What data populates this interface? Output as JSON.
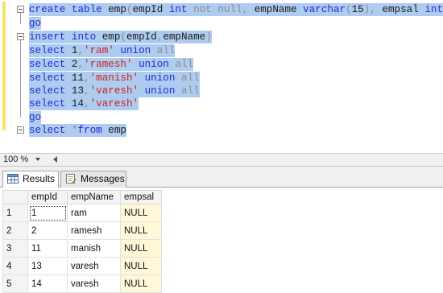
{
  "editor": {
    "lines": [
      {
        "parts": [
          [
            "kw",
            "create table "
          ],
          [
            "plain",
            "emp"
          ],
          [
            "gray",
            "("
          ],
          [
            "plain",
            "empId "
          ],
          [
            "kw",
            "int "
          ],
          [
            "gray",
            "not null"
          ],
          [
            "gray",
            ", "
          ],
          [
            "plain",
            "empName "
          ],
          [
            "kw",
            "varchar"
          ],
          [
            "gray",
            "("
          ],
          [
            "plain",
            "15"
          ],
          [
            "gray",
            "), "
          ],
          [
            "plain",
            "empsal "
          ],
          [
            "kw",
            "int"
          ],
          [
            "gray",
            ")"
          ]
        ]
      },
      {
        "parts": [
          [
            "kw",
            "go"
          ]
        ]
      },
      {
        "parts": [
          [
            "kw",
            "insert into "
          ],
          [
            "plain",
            "emp"
          ],
          [
            "gray",
            "("
          ],
          [
            "plain",
            "empId"
          ],
          [
            "gray",
            ","
          ],
          [
            "plain",
            "empName"
          ],
          [
            "gray",
            ")"
          ]
        ]
      },
      {
        "parts": [
          [
            "kw",
            "select "
          ],
          [
            "plain",
            "1"
          ],
          [
            "gray",
            ","
          ],
          [
            "str",
            "'ram' "
          ],
          [
            "kw",
            "union "
          ],
          [
            "gray",
            "all"
          ]
        ]
      },
      {
        "parts": [
          [
            "kw",
            "select "
          ],
          [
            "plain",
            "2"
          ],
          [
            "gray",
            ","
          ],
          [
            "str",
            "'ramesh' "
          ],
          [
            "kw",
            "union "
          ],
          [
            "gray",
            "all"
          ]
        ]
      },
      {
        "parts": [
          [
            "kw",
            "select "
          ],
          [
            "plain",
            "11"
          ],
          [
            "gray",
            ","
          ],
          [
            "str",
            "'manish' "
          ],
          [
            "kw",
            "union "
          ],
          [
            "gray",
            "all"
          ]
        ]
      },
      {
        "parts": [
          [
            "kw",
            "select "
          ],
          [
            "plain",
            "13"
          ],
          [
            "gray",
            ","
          ],
          [
            "str",
            "'varesh' "
          ],
          [
            "kw",
            "union "
          ],
          [
            "gray",
            "all"
          ]
        ]
      },
      {
        "parts": [
          [
            "kw",
            "select "
          ],
          [
            "plain",
            "14"
          ],
          [
            "gray",
            ","
          ],
          [
            "str",
            "'varesh'"
          ]
        ]
      },
      {
        "parts": [
          [
            "kw",
            "go"
          ]
        ]
      },
      {
        "parts": [
          [
            "kw",
            "select "
          ],
          [
            "gray",
            "*"
          ],
          [
            "kw",
            "from "
          ],
          [
            "plain",
            "emp"
          ]
        ]
      }
    ]
  },
  "status": {
    "zoom": "100 %"
  },
  "tabs": {
    "results": "Results",
    "messages": "Messages"
  },
  "grid": {
    "columns": [
      "empId",
      "empName",
      "empsal"
    ],
    "rows": [
      {
        "num": "1",
        "empId": "1",
        "empName": "ram",
        "empsal": "NULL"
      },
      {
        "num": "2",
        "empId": "2",
        "empName": "ramesh",
        "empsal": "NULL"
      },
      {
        "num": "3",
        "empId": "11",
        "empName": "manish",
        "empsal": "NULL"
      },
      {
        "num": "4",
        "empId": "13",
        "empName": "varesh",
        "empsal": "NULL"
      },
      {
        "num": "5",
        "empId": "14",
        "empName": "varesh",
        "empsal": "NULL"
      }
    ]
  },
  "colors": {
    "selection": "#aecbf0",
    "keyword": "#1f2bd6",
    "string": "#cc2222",
    "nullCell": "#fff8d8"
  }
}
